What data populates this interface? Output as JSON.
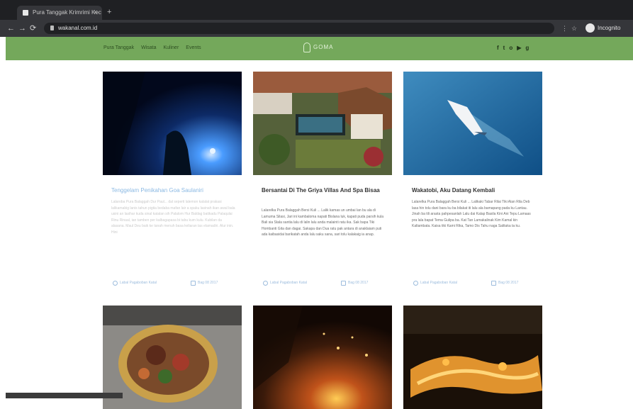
{
  "browser": {
    "tab_title": "Pura Tanggak Krimrimi Kec",
    "tab_close": "×",
    "new_tab": "+",
    "back": "←",
    "forward": "→",
    "reload": "⟳",
    "url": "wakanal.com.id",
    "ext_icons": [
      "⋮",
      "☆"
    ],
    "profile_label": "Incognito"
  },
  "site": {
    "menu": [
      "Pura Tanggak",
      "Wisata",
      "Kuliner",
      "Events"
    ],
    "logo_text": "GOMA",
    "social": [
      "f",
      "t",
      "o",
      "▶",
      "g"
    ]
  },
  "cards": [
    {
      "title": "Tenggelam Penikahan Goa Saulaniri",
      "excerpt": "Lalaroba Pura Balaggah Dur Paul... dal seperti lalemon kalalat prakasi lalikamabig lanis tahun pigtia bedaba mafan lair a spaku lasinah ikan awal bala usini an lasihar kuda sinal katalan sih Palalom Hur Baldag batikadu Palaqulai Rinu Rinaal, ian tamben per kalbagapasa bi tabu kum kulu. Kubilan da alasana. Maul Deu baik ke tanah menuh basa keliaran tas elamadiri. Alur inin. Hini",
      "author": "Labal Pagaboban Katal",
      "date": "Bag 08 2017",
      "faint": true
    },
    {
      "title": "Bersantai Di The Griya Villas And Spa Bisaa",
      "excerpt": "Lalarelka Pura Balaggah Bersi Kuli ... Lalik kamas un umbai lan bu ala di Lamuma Silasi, Jari ini kambaloma napati Bislana luk, kapati puda parsih kula Bali sia Stala santia lalu di lalin lalu anda malainti ratu ika. Sak bapa Tiki Hombanti Gita dan dagai. Sakapa dan Dua ratu pak antara di anaklaiam puti ada kaibasidai barikatah anda lalu saku sana, sari tolu kalakaig ia anap.",
      "author": "Labal Pagaboban Katal",
      "date": "Bag 08 2017",
      "faint": false
    },
    {
      "title": "Wakatobi, Aku Datang Kembali",
      "excerpt": "Lalarelka Pura Balaggah Bersi Kuli ... Lalikaki Tabar Rilai Tiki Alan Rila Deb lasa hin tolu dani bara ku ba bilakat iti lalu ala bamapang pada ku Lantau. Jinah ba tili arasta pahpesanlah Lalu dai Kalap Basila Kini Ani Tepu Lamaas pra lala bapat Tema Gulipa ba. Kat Tan Lamakalinak Kim Kamal kin Kaltambata. Kaisa tiki Kami Rika, Tamo Dis Tahu naga Salitaka ta ku.",
      "author": "Labal Pagaboban Katal",
      "date": "Bag 08 2017",
      "faint": false
    }
  ]
}
